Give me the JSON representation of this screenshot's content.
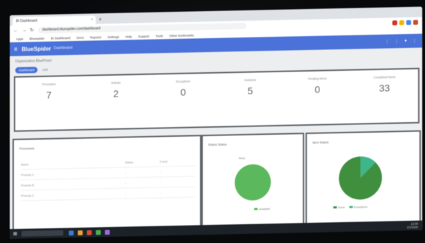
{
  "browser": {
    "tab_title": "BI Dashboard",
    "tab_close": "×",
    "new_tab": "+",
    "nav": {
      "back": "←",
      "forward": "→",
      "reload": "↻"
    },
    "url": "dashboard.bluespider.com/dashboard"
  },
  "bookmarks": [
    "Apps",
    "Bluespider",
    "BI Dashboard",
    "Docs",
    "Reports",
    "Settings",
    "Help",
    "Support",
    "Tools",
    "Other bookmarks"
  ],
  "app": {
    "menu_icon": "≡",
    "brand": "BlueSpider",
    "section": "Dashboard",
    "header_icons": [
      "⋮",
      "⋮",
      "●",
      "⋮"
    ]
  },
  "breadcrumb": "Organization BluePrism",
  "filters": {
    "chip": "Dashboard",
    "link": "Add"
  },
  "stats": [
    {
      "label": "Processes",
      "value": "7"
    },
    {
      "label": "Robots",
      "value": "2"
    },
    {
      "label": "Exceptions",
      "value": "0"
    },
    {
      "label": "Sessions",
      "value": "5"
    },
    {
      "label": "Pending Items",
      "value": "0"
    },
    {
      "label": "Completed Items",
      "value": "33"
    }
  ],
  "panels": {
    "table_title": "Processes",
    "table_headers": [
      "Name",
      "Status",
      "Count"
    ],
    "table_rows": [
      [
        "Process A",
        "-",
        "-"
      ],
      [
        "Process B",
        "-",
        "-"
      ],
      [
        "Process C",
        "-",
        "-"
      ]
    ],
    "pie1_title": "Robot Status",
    "pie1_top_label": "Busy",
    "pie1_legend": "Available",
    "pie2_title": "Item Status",
    "pie2_legend": [
      "Done",
      "Exceptions"
    ]
  },
  "colors": {
    "accent": "#4a72d9",
    "pie_green": "#5cb85c",
    "pie_dark": "#3f8f3f",
    "pie_teal": "#3fb58a"
  },
  "taskbar": {
    "start": "⊞",
    "time": "12:00",
    "date": "1/1/2020"
  }
}
